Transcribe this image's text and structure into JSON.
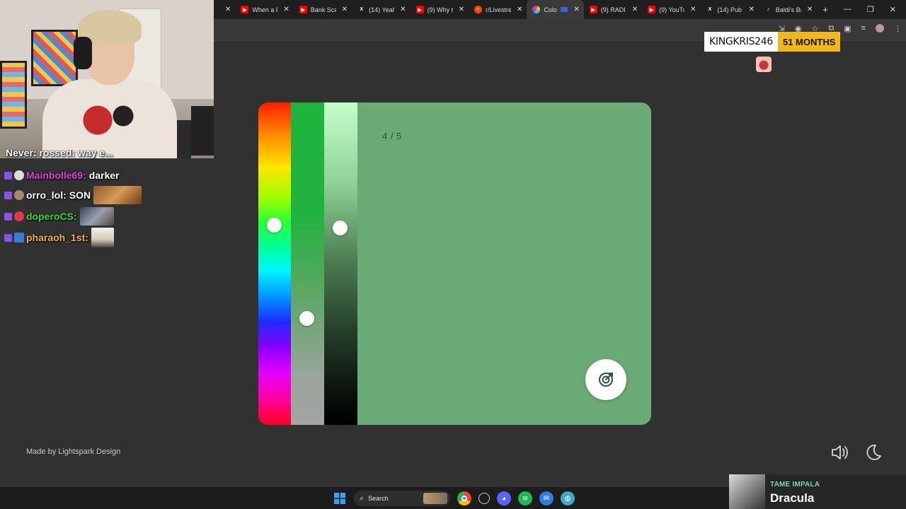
{
  "browser": {
    "tabs": [
      {
        "label": "When a F",
        "favicon": "youtube-icon",
        "color": "#ff0000"
      },
      {
        "label": "Bank Sca",
        "favicon": "youtube-icon",
        "color": "#ff0000"
      },
      {
        "label": "(14) Yeah",
        "favicon": "x-icon",
        "color": "#000000"
      },
      {
        "label": "(9) Why t",
        "favicon": "youtube-icon",
        "color": "#ff0000"
      },
      {
        "label": "r/Livestre",
        "favicon": "reddit-icon",
        "color": "#ff4500"
      },
      {
        "label": "Colo",
        "favicon": "color-wheel-icon",
        "color": "#7a5cff",
        "active": true
      },
      {
        "label": "(9) RADI",
        "favicon": "youtube-icon",
        "color": "#ff0000"
      },
      {
        "label": "(9) YouTu",
        "favicon": "youtube-icon",
        "color": "#ff0000"
      },
      {
        "label": "(14) Pub",
        "favicon": "x-icon",
        "color": "#000000"
      },
      {
        "label": "Baldi's Ba",
        "favicon": "tiktok-icon",
        "color": "#000000"
      }
    ],
    "new_tab_symbol": "+"
  },
  "game": {
    "counter": "4 / 5",
    "credit": "Made by Lightspark Design",
    "target_color": "#6aaa76"
  },
  "chat": {
    "cut_line": "Never: rossed: way e...",
    "messages": [
      {
        "user": "Mainbolle69:",
        "text": "darker",
        "color": "#e53fe5"
      },
      {
        "user": "orro_lol:",
        "text": "SON",
        "color": "#ffffff"
      },
      {
        "user": "doperoCS:",
        "text": "",
        "color": "#3bd83b"
      },
      {
        "user": "pharaoh_1st:",
        "text": "",
        "color": "#f0b53c"
      }
    ]
  },
  "sub_alert": {
    "name": "KINGKRIS246",
    "months": "51 MONTHS"
  },
  "taskbar": {
    "search_label": "Search"
  },
  "now_playing": {
    "artist": "TAME IMPALA",
    "title": "Dracula"
  }
}
